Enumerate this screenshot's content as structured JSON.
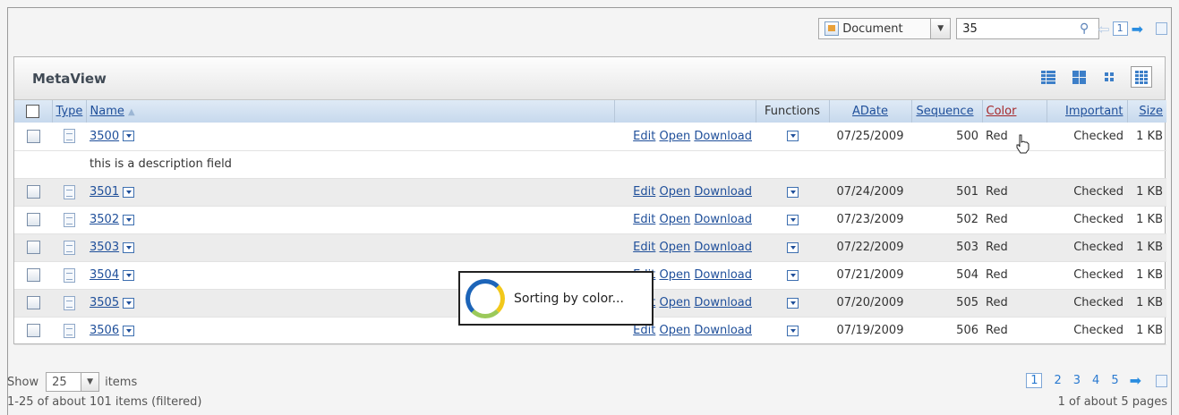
{
  "toolbar": {
    "doc_type": "Document",
    "page_size_value": "35",
    "current_page": "1"
  },
  "panel": {
    "title": "MetaView"
  },
  "columns": {
    "type": "Type",
    "name": "Name",
    "functions": "Functions",
    "adate": "ADate",
    "sequence": "Sequence",
    "color": "Color",
    "important": "Important",
    "size": "Size"
  },
  "row_actions": {
    "edit": "Edit",
    "open": "Open",
    "download": "Download"
  },
  "rows": [
    {
      "name": "3500",
      "date": "07/25/2009",
      "sequence": "500",
      "color": "Red",
      "important": "Checked",
      "size": "1 KB"
    },
    {
      "name": "3501",
      "date": "07/24/2009",
      "sequence": "501",
      "color": "Red",
      "important": "Checked",
      "size": "1 KB"
    },
    {
      "name": "3502",
      "date": "07/23/2009",
      "sequence": "502",
      "color": "Red",
      "important": "Checked",
      "size": "1 KB"
    },
    {
      "name": "3503",
      "date": "07/22/2009",
      "sequence": "503",
      "color": "Red",
      "important": "Checked",
      "size": "1 KB"
    },
    {
      "name": "3504",
      "date": "07/21/2009",
      "sequence": "504",
      "color": "Red",
      "important": "Checked",
      "size": "1 KB"
    },
    {
      "name": "3505",
      "date": "07/20/2009",
      "sequence": "505",
      "color": "Red",
      "important": "Checked",
      "size": "1 KB"
    },
    {
      "name": "3506",
      "date": "07/19/2009",
      "sequence": "506",
      "color": "Red",
      "important": "Checked",
      "size": "1 KB"
    }
  ],
  "description": "this is a description field",
  "overlay": {
    "text": "Sorting by color..."
  },
  "footer": {
    "show_label": "Show",
    "page_size": "25",
    "items_label": "items",
    "count_text": "1-25 of about 101 items (filtered)",
    "pages": [
      "1",
      "2",
      "3",
      "4",
      "5"
    ],
    "pages_text": "1 of about 5 pages"
  }
}
